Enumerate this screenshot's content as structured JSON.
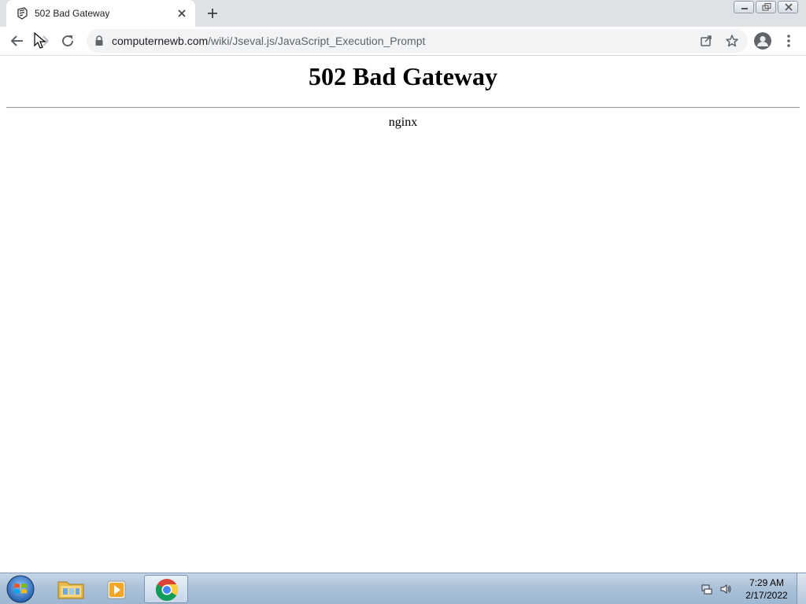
{
  "browser": {
    "tab": {
      "title": "502 Bad Gateway"
    },
    "address_bar": {
      "host": "computernewb.com",
      "path": "/wiki/Jseval.js/JavaScript_Execution_Prompt"
    }
  },
  "page": {
    "heading": "502 Bad Gateway",
    "server": "nginx"
  },
  "taskbar": {
    "time": "7:29 AM",
    "date": "2/17/2022"
  }
}
